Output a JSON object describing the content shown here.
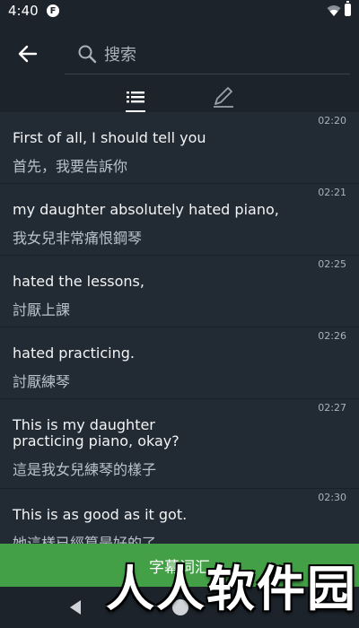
{
  "status": {
    "time": "4:40",
    "app_icon_glyph": "F"
  },
  "search": {
    "placeholder": "搜索",
    "value": ""
  },
  "tabs": [
    {
      "name": "subtitle-list",
      "icon": "list-icon",
      "active": true
    },
    {
      "name": "edit",
      "icon": "pencil-icon",
      "active": false
    }
  ],
  "rows": [
    {
      "time": "02:20",
      "en": "First of all, I should tell you",
      "zh": "首先，我要告訴你"
    },
    {
      "time": "02:21",
      "en": "my daughter absolutely hated piano,",
      "zh": "我女兒非常痛恨鋼琴"
    },
    {
      "time": "02:25",
      "en": "hated the lessons,",
      "zh": "討厭上課"
    },
    {
      "time": "02:26",
      "en": "hated practicing.",
      "zh": "討厭練琴"
    },
    {
      "time": "02:27",
      "en": "This is my daughter practicing piano, okay?",
      "zh": "這是我女兒練琴的樣子"
    },
    {
      "time": "02:30",
      "en": "This is as good as it got.",
      "zh": "她這樣已經算是好的了"
    }
  ],
  "bottom_button": {
    "label": "字幕词汇"
  },
  "watermark": {
    "text": "人人软件园"
  },
  "colors": {
    "background": "#1c232b",
    "row": "#222a33",
    "accent": "#43a047"
  }
}
